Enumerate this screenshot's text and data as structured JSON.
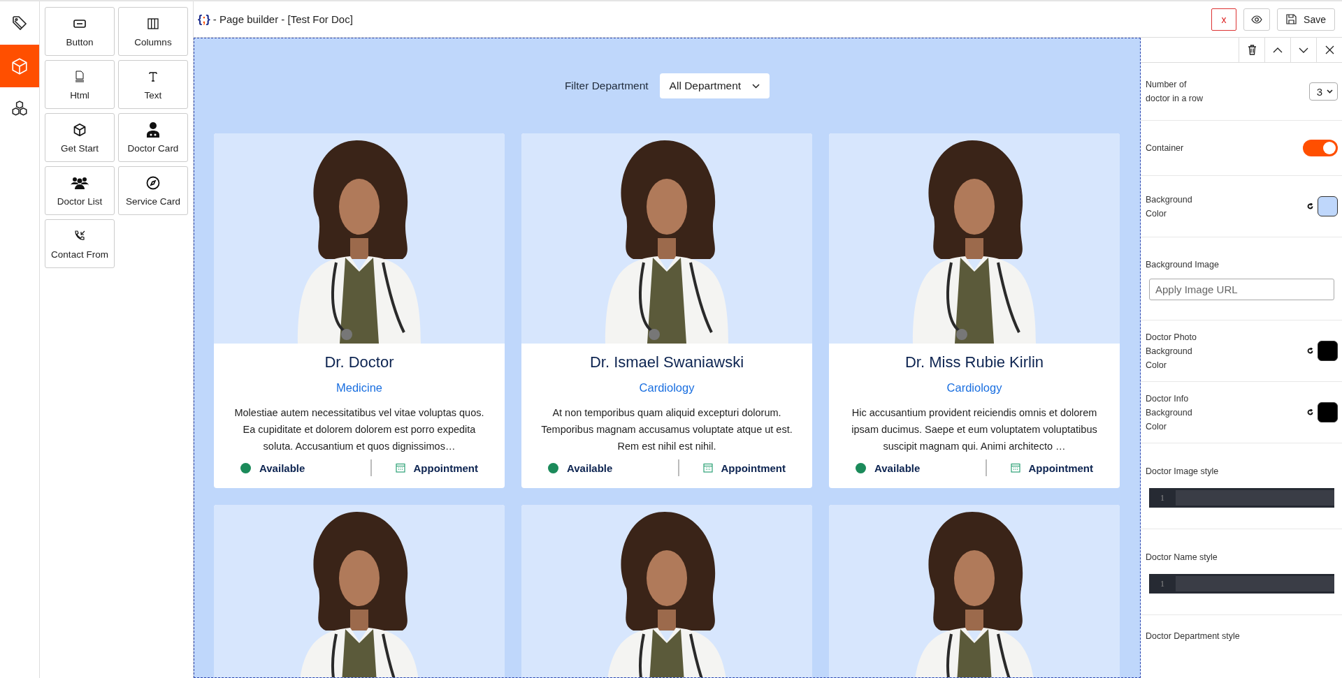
{
  "rail": [
    {
      "selected": false
    },
    {
      "selected": true
    },
    {
      "selected": false
    }
  ],
  "palette": [
    {
      "label": "Button"
    },
    {
      "label": "Columns"
    },
    {
      "label": "Html"
    },
    {
      "label": "Text"
    },
    {
      "label": "Get Start"
    },
    {
      "label": "Doctor Card"
    },
    {
      "label": "Doctor List"
    },
    {
      "label": "Service Card"
    },
    {
      "label": "Contact From"
    }
  ],
  "header": {
    "logo": {
      "open": "{",
      "mark": ";",
      "close": "}"
    },
    "title": "- Page builder - [Test For Doc]",
    "close_button": "x",
    "save_button": "Save"
  },
  "canvas": {
    "filter_label": "Filter Department",
    "filter_value": "All Department",
    "cards": [
      {
        "kind": "doctor",
        "name": "Dr. Doctor",
        "department": "Medicine",
        "bio": "Molestiae autem necessitatibus vel vitae voluptas quos. Ea cupiditate et dolorem dolorem est porro expedita soluta. Accusantium et quos dignissimos…",
        "status": "Available",
        "action": "Appointment"
      },
      {
        "kind": "doctor",
        "name": "Dr. Ismael Swaniawski",
        "department": "Cardiology",
        "bio": "At non temporibus quam aliquid excepturi dolorum. Temporibus magnam accusamus voluptate atque ut est. Rem est nihil est nihil.",
        "status": "Available",
        "action": "Appointment"
      },
      {
        "kind": "doctor",
        "name": "Dr. Miss Rubie Kirlin",
        "department": "Cardiology",
        "bio": "Hic accusantium provident reiciendis omnis et dolorem ipsam ducimus. Saepe et eum voluptatem voluptatibus suscipit magnam qui. Animi architecto …",
        "status": "Available",
        "action": "Appointment"
      },
      {
        "kind": "picture"
      },
      {
        "kind": "picture"
      },
      {
        "kind": "picture"
      }
    ]
  },
  "settings": [
    {
      "kind": "select",
      "label": "Number of doctor in a row",
      "value": "3"
    },
    {
      "kind": "toggle",
      "label": "Container",
      "on": true
    },
    {
      "kind": "color",
      "label": "Background Color",
      "color": "#bfd7fb"
    },
    {
      "kind": "input",
      "label": "Background Image",
      "placeholder": "Apply Image URL"
    },
    {
      "kind": "color",
      "label": "Doctor Photo Background Color",
      "color": "#000000"
    },
    {
      "kind": "color",
      "label": "Doctor Info Background Color",
      "color": "#000000"
    },
    {
      "kind": "code",
      "label": "Doctor Image style",
      "line_number": "1"
    },
    {
      "kind": "code",
      "label": "Doctor Name style",
      "line_number": "1"
    },
    {
      "kind": "code",
      "label": "Doctor Department style"
    }
  ]
}
